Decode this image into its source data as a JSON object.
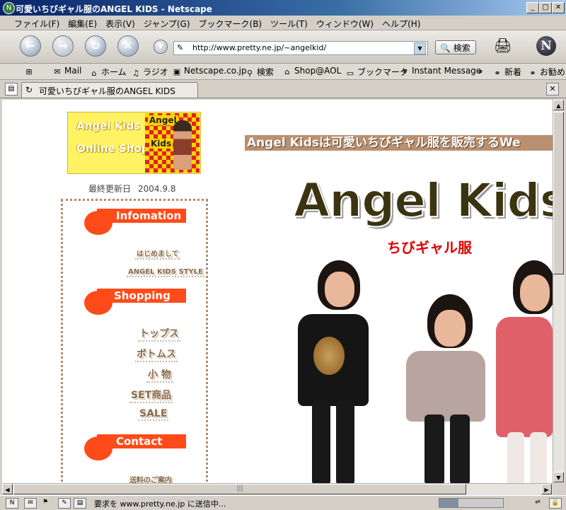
{
  "window": {
    "title": "可愛いちびギャル服のANGEL KIDS - Netscape",
    "minimize": "_",
    "maximize": "□",
    "close": "✕"
  },
  "menu": [
    "ファイル(F)",
    "編集(E)",
    "表示(V)",
    "ジャンプ(G)",
    "ブックマーク(B)",
    "ツール(T)",
    "ウィンドウ(W)",
    "ヘルプ(H)"
  ],
  "nav": {
    "url": "http://www.pretty.ne.jp/~angelkid/",
    "search_label": "検索"
  },
  "personal_toolbar": [
    "Mail",
    "ホーム",
    "ラジオ",
    "Netscape.co.jp",
    "検索",
    "Shop@AOL",
    "ブックマーク",
    "Instant Message",
    "新着",
    "お勧め"
  ],
  "tab": {
    "title": "可愛いちびギャル服のANGEL KIDS"
  },
  "page": {
    "logo_line1": "Angel Kids",
    "logo_line2": "Online Shop",
    "logo_photo_text1": "Angel",
    "logo_photo_text2": "Kids",
    "updated_label": "最終更新日",
    "updated_date": "2004.9.8",
    "sections": [
      {
        "title": "Infomation",
        "links": [
          "はじめまして",
          "ANGEL KIDS STYLE"
        ]
      },
      {
        "title": "Shopping",
        "links": [
          "トップス",
          "ボトムス",
          "小 物",
          "SET商品",
          "SALE"
        ]
      },
      {
        "title": "Contact",
        "links": [
          "送料のご案内"
        ]
      }
    ],
    "tagline": "Angel Kidsは可愛いちびギャル服を販売するWe",
    "big_title": "Angel Kids",
    "subtitle": "ちびギャル服"
  },
  "status": {
    "message": "要求を www.pretty.ne.jp に送信中...",
    "progress_fraction": 0.3
  },
  "colors": {
    "accent": "#ff4b19",
    "subtitle_red": "#e00000",
    "title_bar": "#0a246a"
  }
}
